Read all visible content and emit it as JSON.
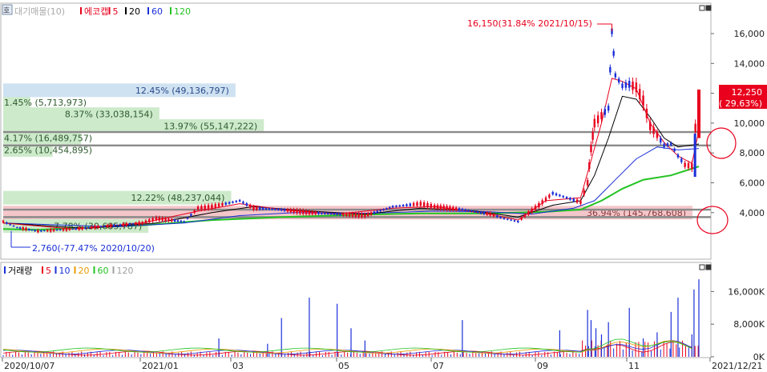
{
  "legend_top": {
    "prefix": "대기매물(10)",
    "series": [
      {
        "name": "에코캡",
        "color": "#e8001c"
      },
      {
        "name": "5",
        "color": "#e8001c"
      },
      {
        "name": "20",
        "color": "#000000"
      },
      {
        "name": "60",
        "color": "#1a2fd8"
      },
      {
        "name": "120",
        "color": "#22c322"
      }
    ]
  },
  "legend_volume": {
    "series": [
      {
        "name": "거래량",
        "color": "#1a2fd8"
      },
      {
        "name": "5",
        "color": "#e8001c"
      },
      {
        "name": "10",
        "color": "#1a2fd8"
      },
      {
        "name": "20",
        "color": "#e89a00"
      },
      {
        "name": "60",
        "color": "#22c322"
      },
      {
        "name": "120",
        "color": "#a0a0a0"
      }
    ]
  },
  "side_button": "호",
  "chart_data": {
    "type": "candlestick",
    "price_axis": {
      "ticks": [
        "16,000",
        "14,000",
        "12,000",
        "10,000",
        "8,000",
        "6,000",
        "4,000"
      ],
      "values": [
        16000,
        14000,
        12000,
        10000,
        8000,
        6000,
        4000
      ],
      "range": [
        1200,
        17500
      ]
    },
    "volume_axis": {
      "ticks": [
        "16,000K",
        "8,000K",
        "0K"
      ],
      "values": [
        16000,
        8000,
        0
      ],
      "range": [
        0,
        20000
      ]
    },
    "x_ticks": [
      "2020/10/07",
      "2021/01",
      "03",
      "05",
      "07",
      "09",
      "11",
      "2021/12/21"
    ],
    "high_annotation": "16,150(31.84% 2021/10/15)",
    "low_annotation": "2,760(-77.47% 2020/10/20)",
    "last_price": {
      "value": "12,250",
      "change": "( 29.63%)"
    },
    "volume_profile": [
      {
        "label": "36.94% (145,768,608)",
        "pct": 36.94,
        "price": 4000
      },
      {
        "label": "7.78% (30,685,787)",
        "pct": 7.78,
        "price": 3100
      },
      {
        "label": "12.22% (48,237,044)",
        "pct": 12.22,
        "price": 5000
      },
      {
        "label": "2.65% (10,454,895)",
        "pct": 2.65,
        "price": 8200
      },
      {
        "label": "4.17% (16,489,757)",
        "pct": 4.17,
        "price": 9000
      },
      {
        "label": "13.97% (55,147,222)",
        "pct": 13.97,
        "price": 9800
      },
      {
        "label": "8.37% (33,038,154)",
        "pct": 8.37,
        "price": 10600
      },
      {
        "label": "1.45% (5,713,973)",
        "pct": 1.45,
        "price": 11400
      },
      {
        "label": "12.45% (49,136,797)",
        "pct": 12.45,
        "price": 12200
      }
    ],
    "horizontal_lines": [
      9400,
      8500,
      4200,
      3700
    ],
    "price_path": [
      [
        0,
        3400
      ],
      [
        0.02,
        3000
      ],
      [
        0.05,
        2760
      ],
      [
        0.1,
        2900
      ],
      [
        0.15,
        3100
      ],
      [
        0.2,
        3300
      ],
      [
        0.22,
        3600
      ],
      [
        0.26,
        3400
      ],
      [
        0.28,
        4300
      ],
      [
        0.3,
        4400
      ],
      [
        0.32,
        4600
      ],
      [
        0.34,
        4800
      ],
      [
        0.36,
        4300
      ],
      [
        0.4,
        4200
      ],
      [
        0.44,
        4000
      ],
      [
        0.48,
        3900
      ],
      [
        0.52,
        3800
      ],
      [
        0.56,
        4400
      ],
      [
        0.58,
        4500
      ],
      [
        0.6,
        4600
      ],
      [
        0.62,
        4400
      ],
      [
        0.66,
        4200
      ],
      [
        0.7,
        3900
      ],
      [
        0.72,
        3600
      ],
      [
        0.74,
        3400
      ],
      [
        0.75,
        3800
      ],
      [
        0.77,
        4500
      ],
      [
        0.79,
        5300
      ],
      [
        0.81,
        5000
      ],
      [
        0.83,
        4700
      ],
      [
        0.84,
        6000
      ],
      [
        0.845,
        8300
      ],
      [
        0.85,
        10000
      ],
      [
        0.86,
        10500
      ],
      [
        0.87,
        11000
      ],
      [
        0.875,
        16150
      ],
      [
        0.88,
        13200
      ],
      [
        0.89,
        12500
      ],
      [
        0.9,
        12600
      ],
      [
        0.91,
        12400
      ],
      [
        0.92,
        11500
      ],
      [
        0.93,
        9800
      ],
      [
        0.94,
        9200
      ],
      [
        0.95,
        8500
      ],
      [
        0.96,
        8600
      ],
      [
        0.97,
        7800
      ],
      [
        0.98,
        7200
      ],
      [
        0.99,
        7100
      ],
      [
        1.0,
        12250
      ]
    ],
    "ma5_path": [
      [
        0,
        3300
      ],
      [
        0.1,
        2900
      ],
      [
        0.2,
        3300
      ],
      [
        0.28,
        4100
      ],
      [
        0.34,
        4600
      ],
      [
        0.4,
        4200
      ],
      [
        0.48,
        3900
      ],
      [
        0.56,
        4300
      ],
      [
        0.62,
        4400
      ],
      [
        0.7,
        3900
      ],
      [
        0.74,
        3500
      ],
      [
        0.78,
        4800
      ],
      [
        0.83,
        5000
      ],
      [
        0.845,
        7500
      ],
      [
        0.86,
        10000
      ],
      [
        0.875,
        13000
      ],
      [
        0.89,
        12800
      ],
      [
        0.91,
        12300
      ],
      [
        0.93,
        10000
      ],
      [
        0.95,
        8700
      ],
      [
        0.97,
        7800
      ],
      [
        0.99,
        7300
      ],
      [
        1.0,
        9500
      ]
    ],
    "ma20_path": [
      [
        0,
        3300
      ],
      [
        0.12,
        2950
      ],
      [
        0.22,
        3300
      ],
      [
        0.3,
        4000
      ],
      [
        0.36,
        4400
      ],
      [
        0.44,
        4100
      ],
      [
        0.52,
        3900
      ],
      [
        0.6,
        4300
      ],
      [
        0.68,
        4100
      ],
      [
        0.74,
        3700
      ],
      [
        0.79,
        4500
      ],
      [
        0.83,
        4800
      ],
      [
        0.85,
        6500
      ],
      [
        0.87,
        9000
      ],
      [
        0.89,
        11800
      ],
      [
        0.91,
        11600
      ],
      [
        0.93,
        10400
      ],
      [
        0.95,
        9000
      ],
      [
        0.97,
        8400
      ],
      [
        1.0,
        8600
      ]
    ],
    "ma60_path": [
      [
        0,
        3300
      ],
      [
        0.16,
        3050
      ],
      [
        0.26,
        3300
      ],
      [
        0.34,
        3800
      ],
      [
        0.42,
        4000
      ],
      [
        0.52,
        3950
      ],
      [
        0.62,
        4100
      ],
      [
        0.7,
        4050
      ],
      [
        0.76,
        3900
      ],
      [
        0.82,
        4300
      ],
      [
        0.85,
        4800
      ],
      [
        0.88,
        6200
      ],
      [
        0.91,
        7600
      ],
      [
        0.94,
        8400
      ],
      [
        0.97,
        8200
      ],
      [
        1.0,
        8300
      ]
    ],
    "ma120_path": [
      [
        0,
        2900
      ],
      [
        0.05,
        2850
      ],
      [
        0.12,
        3000
      ],
      [
        0.2,
        3150
      ],
      [
        0.3,
        3500
      ],
      [
        0.4,
        3700
      ],
      [
        0.5,
        3850
      ],
      [
        0.6,
        3950
      ],
      [
        0.7,
        3950
      ],
      [
        0.78,
        4050
      ],
      [
        0.83,
        4200
      ],
      [
        0.86,
        4800
      ],
      [
        0.89,
        5600
      ],
      [
        0.92,
        6200
      ],
      [
        0.96,
        6500
      ],
      [
        1.0,
        7100
      ]
    ],
    "volume_spikes": [
      [
        0.31,
        4500
      ],
      [
        0.38,
        3200
      ],
      [
        0.4,
        9500
      ],
      [
        0.44,
        14500
      ],
      [
        0.48,
        13000
      ],
      [
        0.5,
        7000
      ],
      [
        0.52,
        4000
      ],
      [
        0.66,
        9000
      ],
      [
        0.8,
        6500
      ],
      [
        0.84,
        11500
      ],
      [
        0.845,
        9000
      ],
      [
        0.852,
        7000
      ],
      [
        0.86,
        5500
      ],
      [
        0.87,
        8500
      ],
      [
        0.9,
        12000
      ],
      [
        0.92,
        4500
      ],
      [
        0.94,
        6000
      ],
      [
        0.96,
        11000
      ],
      [
        0.97,
        14500
      ],
      [
        0.99,
        5500
      ],
      [
        1.0,
        19000
      ],
      [
        0.993,
        16500
      ]
    ]
  }
}
